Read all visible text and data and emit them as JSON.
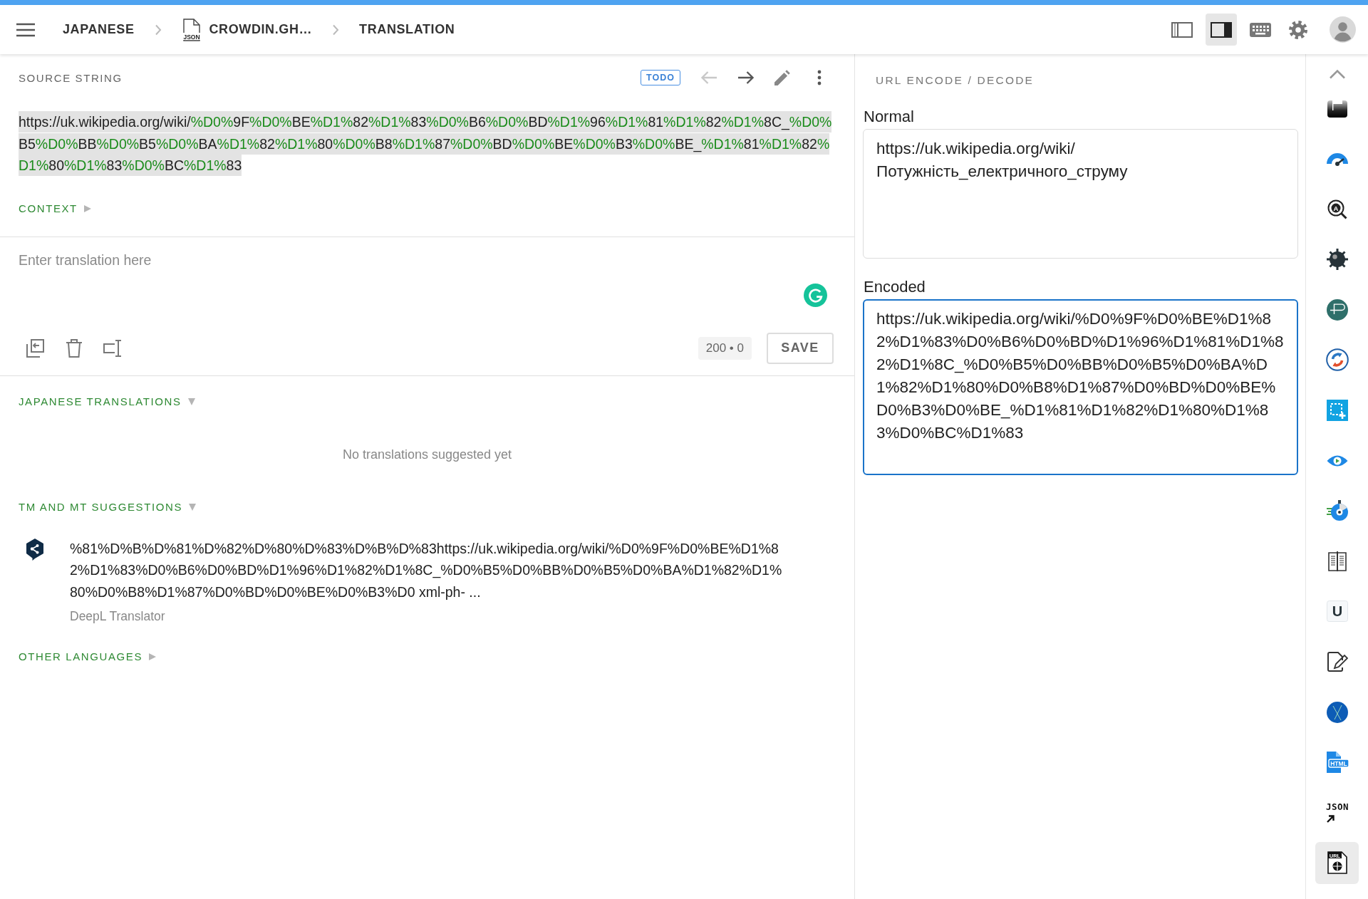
{
  "header": {
    "breadcrumb": [
      {
        "kind": "language",
        "label": "JAPANESE"
      },
      {
        "kind": "file",
        "file_type": "JSON",
        "label": "CROWDIN.GH…"
      },
      {
        "kind": "page",
        "label": "TRANSLATION"
      }
    ],
    "layout_toggles": [
      {
        "kind": "left-panel",
        "selected": false
      },
      {
        "kind": "right-panel",
        "selected": true
      }
    ]
  },
  "source": {
    "title": "SOURCE STRING",
    "status": "TODO",
    "nav": [
      {
        "kind": "previous",
        "disabled": true
      },
      {
        "kind": "next",
        "disabled": false
      }
    ],
    "segments": [
      {
        "text": "https://uk.wikipedia.org/wiki/",
        "kind": "plain"
      },
      {
        "text": "%D0%",
        "kind": "code"
      },
      {
        "text": "9F",
        "kind": "plain"
      },
      {
        "text": "%D0%",
        "kind": "code"
      },
      {
        "text": "BE",
        "kind": "plain"
      },
      {
        "text": "%D1%",
        "kind": "code"
      },
      {
        "text": "82",
        "kind": "plain"
      },
      {
        "text": "%D1%",
        "kind": "code"
      },
      {
        "text": "83",
        "kind": "plain"
      },
      {
        "text": "%D0%",
        "kind": "code"
      },
      {
        "text": "B6",
        "kind": "plain"
      },
      {
        "text": "%D0%",
        "kind": "code"
      },
      {
        "text": "BD",
        "kind": "plain"
      },
      {
        "text": "%D1%",
        "kind": "code"
      },
      {
        "text": "96",
        "kind": "plain"
      },
      {
        "text": "%D1%",
        "kind": "code"
      },
      {
        "text": "81",
        "kind": "plain"
      },
      {
        "text": "%D1%",
        "kind": "code"
      },
      {
        "text": "82",
        "kind": "plain"
      },
      {
        "text": "%D1%",
        "kind": "code"
      },
      {
        "text": "8C_",
        "kind": "plain"
      },
      {
        "text": "%D0%",
        "kind": "code"
      },
      {
        "text": "B5",
        "kind": "plain"
      },
      {
        "text": "%D0%",
        "kind": "code"
      },
      {
        "text": "BB",
        "kind": "plain"
      },
      {
        "text": "%D0%",
        "kind": "code"
      },
      {
        "text": "B5",
        "kind": "plain"
      },
      {
        "text": "%D0%",
        "kind": "code"
      },
      {
        "text": "BA",
        "kind": "plain"
      },
      {
        "text": "%D1%",
        "kind": "code"
      },
      {
        "text": "82",
        "kind": "plain"
      },
      {
        "text": "%D1%",
        "kind": "code"
      },
      {
        "text": "80",
        "kind": "plain"
      },
      {
        "text": "%D0%",
        "kind": "code"
      },
      {
        "text": "B8",
        "kind": "plain"
      },
      {
        "text": "%D1%",
        "kind": "code"
      },
      {
        "text": "87",
        "kind": "plain"
      },
      {
        "text": "%D0%",
        "kind": "code"
      },
      {
        "text": "BD",
        "kind": "plain"
      },
      {
        "text": "%D0%",
        "kind": "code"
      },
      {
        "text": "BE",
        "kind": "plain"
      },
      {
        "text": "%D0%",
        "kind": "code"
      },
      {
        "text": "B3",
        "kind": "plain"
      },
      {
        "text": "%D0%",
        "kind": "code"
      },
      {
        "text": "BE_",
        "kind": "plain"
      },
      {
        "text": "%D1%",
        "kind": "code"
      },
      {
        "text": "81",
        "kind": "plain"
      },
      {
        "text": "%D1%",
        "kind": "code"
      },
      {
        "text": "82",
        "kind": "plain"
      },
      {
        "text": "%D1%",
        "kind": "code"
      },
      {
        "text": "80",
        "kind": "plain"
      },
      {
        "text": "%D1%",
        "kind": "code"
      },
      {
        "text": "83",
        "kind": "plain"
      },
      {
        "text": "%D0%",
        "kind": "code"
      },
      {
        "text": "BC",
        "kind": "plain"
      },
      {
        "text": "%D1%",
        "kind": "code"
      },
      {
        "text": "83",
        "kind": "plain"
      }
    ],
    "context": {
      "label": "CONTEXT",
      "expanded": false
    }
  },
  "editor": {
    "placeholder": "Enter translation here",
    "counter": "200 • 0",
    "save": "SAVE"
  },
  "sections": [
    {
      "kind": "translations",
      "title": "JAPANESE TRANSLATIONS",
      "expanded": true,
      "empty_text": "No translations suggested yet"
    },
    {
      "kind": "suggestions",
      "title": "TM AND MT SUGGESTIONS",
      "expanded": true,
      "suggestions": [
        {
          "text": "%81%D%B%D%81%D%82%D%80%D%83%D%B%D%83https://uk.wikipedia.org/wiki/%D0%9F%D0%BE%D1%82%D1%83%D0%B6%D0%BD%D1%96%D1%82%D1%8C_%D0%B5%D0%BB%D0%B5%D0%BA%D1%82%D1%80%D0%B8%D1%87%D0%BD%D0%BE%D0%B3%D0 xml-ph- ...",
          "source": "DeepL Translator"
        }
      ]
    },
    {
      "kind": "languages",
      "title": "OTHER LANGUAGES",
      "expanded": false
    }
  ],
  "tool_panel": {
    "title": "URL ENCODE / DECODE",
    "fields": [
      {
        "kind": "decoded",
        "label": "Normal",
        "value": "https://uk.wikipedia.org/wiki/Потужність_електричного_струму",
        "focused": false
      },
      {
        "kind": "encoded",
        "label": "Encoded",
        "value": "https://uk.wikipedia.org/wiki/%D0%9F%D0%BE%D1%82%D1%83%D0%B6%D0%BD%D1%96%D1%81%D1%82%D1%8C_%D0%B5%D0%BB%D0%B5%D0%BA%D1%82%D1%80%D0%B8%D1%87%D0%BD%D0%BE%D0%B3%D0%BE_%D1%81%D1%82%D1%80%D1%83%D0%BC%D1%83",
        "focused": true
      }
    ]
  },
  "app_rail": [
    {
      "kind": "dark-tile",
      "selected": false
    },
    {
      "kind": "gauge",
      "selected": false
    },
    {
      "kind": "magnifier",
      "label": "A",
      "selected": false
    },
    {
      "kind": "mine",
      "selected": false
    },
    {
      "kind": "bracket-circle",
      "selected": false
    },
    {
      "kind": "sync",
      "selected": false
    },
    {
      "kind": "selection",
      "selected": false
    },
    {
      "kind": "eye",
      "selected": false
    },
    {
      "kind": "stopwatch",
      "selected": false
    },
    {
      "kind": "book",
      "selected": false
    },
    {
      "kind": "letter",
      "label": "U",
      "selected": false
    },
    {
      "kind": "edit-document",
      "selected": false
    },
    {
      "kind": "crossed-circle",
      "selected": false
    },
    {
      "kind": "html-file",
      "label": "HTML",
      "selected": false
    },
    {
      "kind": "json-arrow",
      "label": "JSON",
      "selected": false
    },
    {
      "kind": "url-file",
      "label": "URL",
      "selected": true
    }
  ]
}
